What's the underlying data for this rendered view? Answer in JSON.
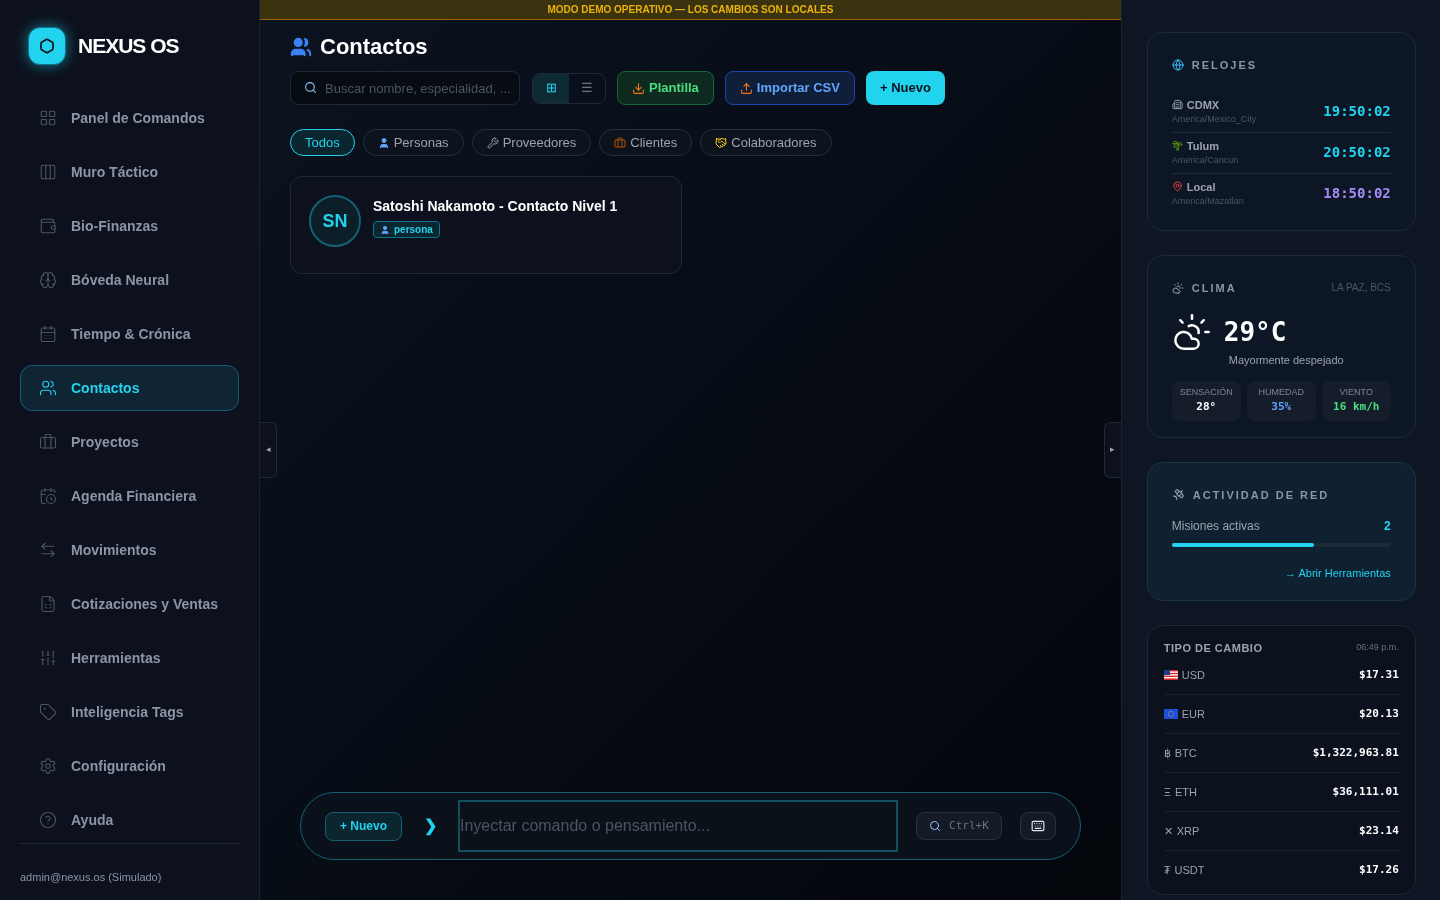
{
  "sidebar": {
    "brand": "NEXUS OS",
    "items": [
      {
        "label": "Panel de Comandos",
        "selected": false
      },
      {
        "label": "Muro Táctico",
        "selected": false
      },
      {
        "label": "Bio-Finanzas",
        "selected": false
      },
      {
        "label": "Bóveda Neural",
        "selected": false
      },
      {
        "label": "Tiempo & Crónica",
        "selected": false
      },
      {
        "label": "Contactos",
        "selected": true
      },
      {
        "label": "Proyectos",
        "selected": false
      },
      {
        "label": "Agenda Financiera",
        "selected": false
      },
      {
        "label": "Movimientos",
        "selected": false
      },
      {
        "label": "Cotizaciones y Ventas",
        "selected": false
      },
      {
        "label": "Herramientas",
        "selected": false
      },
      {
        "label": "Inteligencia Tags",
        "selected": false
      },
      {
        "label": "Configuración",
        "selected": false
      },
      {
        "label": "Ayuda",
        "selected": false
      }
    ],
    "user": "admin@nexus.os (Simulado)"
  },
  "banner": "MODO DEMO OPERATIVO — LOS CAMBIOS SON LOCALES",
  "handles": {
    "left": "◂",
    "right": "▸"
  },
  "page": {
    "title": "Contactos",
    "search": {
      "placeholder": "Buscar nombre, especialidad, ..."
    },
    "view_toggle": [
      {
        "label": "⊞",
        "selected": true
      },
      {
        "label": "☰",
        "selected": false
      }
    ],
    "buttons": [
      {
        "label": "Plantilla",
        "kind": "green"
      },
      {
        "label": "Importar CSV",
        "kind": "blue"
      },
      {
        "label": "+ Nuevo",
        "kind": "primary"
      }
    ],
    "filters": [
      {
        "label": "Todos",
        "selected": true
      },
      {
        "label": "Personas",
        "selected": false
      },
      {
        "label": "Proveedores",
        "selected": false
      },
      {
        "label": "Clientes",
        "selected": false
      },
      {
        "label": "Colaboradores",
        "selected": false
      }
    ],
    "contacts": [
      {
        "initials": "SN",
        "name": "Satoshi Nakamoto - Contacto Nivel 1",
        "tag": "persona"
      }
    ]
  },
  "command_bar": {
    "new": "+ Nuevo",
    "prompt": "❯",
    "placeholder": "Inyectar comando o pensamiento...",
    "shortcut": "Ctrl+K"
  },
  "clocks": {
    "title": "RELOJES",
    "items": [
      {
        "city": "CDMX",
        "zone": "America/Mexico_City",
        "time": "19:50:02",
        "color": "#22d3ee"
      },
      {
        "city": "Tulum",
        "zone": "America/Cancun",
        "time": "20:50:02",
        "color": "#22d3ee"
      },
      {
        "city": "Local",
        "zone": "America/Mazatlan",
        "time": "18:50:02",
        "color": "#a78bfa"
      }
    ]
  },
  "weather": {
    "title": "CLIMA",
    "location": "LA PAZ, BCS",
    "temp": "29°C",
    "desc": "Mayormente despejado",
    "stats": [
      {
        "label": "SENSACIÓN",
        "value": "28°",
        "color": "#ffffff"
      },
      {
        "label": "HUMEDAD",
        "value": "35%",
        "color": "#60a5fa"
      },
      {
        "label": "VIENTO",
        "value": "16 km/h",
        "color": "#4ade80"
      }
    ]
  },
  "network": {
    "title": "ACTIVIDAD DE RED",
    "label": "Misiones activas",
    "count": "2",
    "level": 0.65,
    "link": "→ Abrir Herramientas"
  },
  "rates": {
    "title": "TIPO DE CAMBIO",
    "time": "06:49 p.m.",
    "items": [
      {
        "code": "USD",
        "value": "$17.31"
      },
      {
        "code": "EUR",
        "value": "$20.13"
      },
      {
        "symbol": "฿",
        "code": "BTC",
        "value": "$1,322,963.81"
      },
      {
        "symbol": "Ξ",
        "code": "ETH",
        "value": "$36,111.01"
      },
      {
        "symbol": "✕",
        "code": "XRP",
        "value": "$23.14"
      },
      {
        "symbol": "₮",
        "code": "USDT",
        "value": "$17.26"
      }
    ]
  }
}
